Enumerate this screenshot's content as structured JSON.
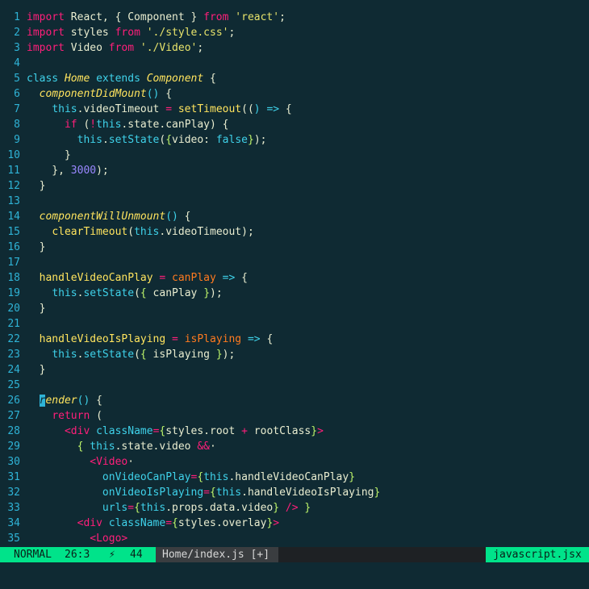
{
  "editor": {
    "lines": [
      {
        "n": "1",
        "t": [
          [
            "k",
            "import"
          ],
          [
            "w",
            " React, { Component } "
          ],
          [
            "k",
            "from"
          ],
          [
            "s",
            " 'react'"
          ],
          [
            "w",
            ";"
          ]
        ]
      },
      {
        "n": "2",
        "t": [
          [
            "k",
            "import"
          ],
          [
            "w",
            " styles "
          ],
          [
            "k",
            "from"
          ],
          [
            "s",
            " './style.css'"
          ],
          [
            "w",
            ";"
          ]
        ]
      },
      {
        "n": "3",
        "t": [
          [
            "k",
            "import"
          ],
          [
            "w",
            " Video "
          ],
          [
            "k",
            "from"
          ],
          [
            "s",
            " './Video'"
          ],
          [
            "w",
            ";"
          ]
        ]
      },
      {
        "n": "4",
        "t": []
      },
      {
        "n": "5",
        "t": [
          [
            "c",
            "class "
          ],
          [
            "yi",
            "Home "
          ],
          [
            "c",
            "extends "
          ],
          [
            "yi",
            "Component"
          ],
          [
            "w",
            " {"
          ]
        ]
      },
      {
        "n": "6",
        "t": [
          [
            "w",
            "  "
          ],
          [
            "yi",
            "componentDidMount"
          ],
          [
            "c",
            "()"
          ],
          [
            "w",
            " {"
          ]
        ]
      },
      {
        "n": "7",
        "t": [
          [
            "w",
            "    "
          ],
          [
            "c",
            "this"
          ],
          [
            "w",
            ".videoTimeout "
          ],
          [
            "k",
            "="
          ],
          [
            "w",
            " "
          ],
          [
            "y",
            "setTimeout"
          ],
          [
            "w",
            "(("
          ],
          [
            "c",
            ")"
          ],
          [
            "w",
            " "
          ],
          [
            "c",
            "=>"
          ],
          [
            "w",
            " {"
          ]
        ]
      },
      {
        "n": "8",
        "t": [
          [
            "w",
            "      "
          ],
          [
            "k",
            "if"
          ],
          [
            "w",
            " ("
          ],
          [
            "k",
            "!"
          ],
          [
            "c",
            "this"
          ],
          [
            "w",
            ".state.canPlay) {"
          ]
        ]
      },
      {
        "n": "9",
        "t": [
          [
            "w",
            "        "
          ],
          [
            "c",
            "this"
          ],
          [
            "w",
            "."
          ],
          [
            "c",
            "setState"
          ],
          [
            "w",
            "("
          ],
          [
            "p",
            "{"
          ],
          [
            "w",
            "video: "
          ],
          [
            "c",
            "false"
          ],
          [
            "p",
            "}"
          ],
          [
            "w",
            ");"
          ]
        ]
      },
      {
        "n": "10",
        "t": [
          [
            "w",
            "      }"
          ]
        ]
      },
      {
        "n": "11",
        "t": [
          [
            "w",
            "    }, "
          ],
          [
            "n",
            "3000"
          ],
          [
            "w",
            ");"
          ]
        ]
      },
      {
        "n": "12",
        "t": [
          [
            "w",
            "  }"
          ]
        ]
      },
      {
        "n": "13",
        "t": []
      },
      {
        "n": "14",
        "t": [
          [
            "w",
            "  "
          ],
          [
            "yi",
            "componentWillUnmount"
          ],
          [
            "c",
            "()"
          ],
          [
            "w",
            " {"
          ]
        ]
      },
      {
        "n": "15",
        "t": [
          [
            "w",
            "    "
          ],
          [
            "y",
            "clearTimeout"
          ],
          [
            "w",
            "("
          ],
          [
            "c",
            "this"
          ],
          [
            "w",
            ".videoTimeout);"
          ]
        ]
      },
      {
        "n": "16",
        "t": [
          [
            "w",
            "  }"
          ]
        ]
      },
      {
        "n": "17",
        "t": []
      },
      {
        "n": "18",
        "t": [
          [
            "w",
            "  "
          ],
          [
            "y",
            "handleVideoCanPlay"
          ],
          [
            "w",
            " "
          ],
          [
            "k",
            "="
          ],
          [
            "w",
            " "
          ],
          [
            "o",
            "canPlay"
          ],
          [
            "w",
            " "
          ],
          [
            "c",
            "=>"
          ],
          [
            "w",
            " {"
          ]
        ]
      },
      {
        "n": "19",
        "t": [
          [
            "w",
            "    "
          ],
          [
            "c",
            "this"
          ],
          [
            "w",
            "."
          ],
          [
            "c",
            "setState"
          ],
          [
            "w",
            "("
          ],
          [
            "p",
            "{"
          ],
          [
            "w",
            " canPlay "
          ],
          [
            "p",
            "}"
          ],
          [
            "w",
            ");"
          ]
        ]
      },
      {
        "n": "20",
        "t": [
          [
            "w",
            "  }"
          ]
        ]
      },
      {
        "n": "21",
        "t": []
      },
      {
        "n": "22",
        "t": [
          [
            "w",
            "  "
          ],
          [
            "y",
            "handleVideoIsPlaying"
          ],
          [
            "w",
            " "
          ],
          [
            "k",
            "="
          ],
          [
            "w",
            " "
          ],
          [
            "o",
            "isPlaying"
          ],
          [
            "w",
            " "
          ],
          [
            "c",
            "=>"
          ],
          [
            "w",
            " {"
          ]
        ]
      },
      {
        "n": "23",
        "t": [
          [
            "w",
            "    "
          ],
          [
            "c",
            "this"
          ],
          [
            "w",
            "."
          ],
          [
            "c",
            "setState"
          ],
          [
            "w",
            "("
          ],
          [
            "p",
            "{"
          ],
          [
            "w",
            " isPlaying "
          ],
          [
            "p",
            "}"
          ],
          [
            "w",
            ");"
          ]
        ]
      },
      {
        "n": "24",
        "t": [
          [
            "w",
            "  }"
          ]
        ]
      },
      {
        "n": "25",
        "t": []
      },
      {
        "n": "26",
        "t": [
          [
            "w",
            "  "
          ],
          [
            "cur",
            "r"
          ],
          [
            "yi",
            "ender"
          ],
          [
            "c",
            "()"
          ],
          [
            "w",
            " {"
          ]
        ]
      },
      {
        "n": "27",
        "t": [
          [
            "w",
            "    "
          ],
          [
            "k",
            "return"
          ],
          [
            "w",
            " ("
          ]
        ]
      },
      {
        "n": "28",
        "t": [
          [
            "w",
            "      "
          ],
          [
            "k",
            "<"
          ],
          [
            "k",
            "div"
          ],
          [
            "w",
            " "
          ],
          [
            "c",
            "className"
          ],
          [
            "k",
            "="
          ],
          [
            "p",
            "{"
          ],
          [
            "w",
            "styles.root "
          ],
          [
            "k",
            "+"
          ],
          [
            "w",
            " rootClass"
          ],
          [
            "p",
            "}"
          ],
          [
            "k",
            ">"
          ]
        ]
      },
      {
        "n": "29",
        "t": [
          [
            "w",
            "        "
          ],
          [
            "p",
            "{"
          ],
          [
            "w",
            " "
          ],
          [
            "c",
            "this"
          ],
          [
            "w",
            ".state.video "
          ],
          [
            "k",
            "&&"
          ],
          [
            "w",
            "·"
          ]
        ]
      },
      {
        "n": "30",
        "t": [
          [
            "w",
            "          "
          ],
          [
            "k",
            "<Video"
          ],
          [
            "w",
            "·"
          ]
        ]
      },
      {
        "n": "31",
        "t": [
          [
            "w",
            "            "
          ],
          [
            "c",
            "onVideoCanPlay"
          ],
          [
            "k",
            "="
          ],
          [
            "p",
            "{"
          ],
          [
            "c",
            "this"
          ],
          [
            "w",
            ".handleVideoCanPlay"
          ],
          [
            "p",
            "}"
          ]
        ]
      },
      {
        "n": "32",
        "t": [
          [
            "w",
            "            "
          ],
          [
            "c",
            "onVideoIsPlaying"
          ],
          [
            "k",
            "="
          ],
          [
            "p",
            "{"
          ],
          [
            "c",
            "this"
          ],
          [
            "w",
            ".handleVideoIsPlaying"
          ],
          [
            "p",
            "}"
          ]
        ]
      },
      {
        "n": "33",
        "t": [
          [
            "w",
            "            "
          ],
          [
            "c",
            "urls"
          ],
          [
            "k",
            "="
          ],
          [
            "p",
            "{"
          ],
          [
            "c",
            "this"
          ],
          [
            "w",
            ".props.data.video"
          ],
          [
            "p",
            "}"
          ],
          [
            "w",
            " "
          ],
          [
            "k",
            "/>"
          ],
          [
            "w",
            " "
          ],
          [
            "p",
            "}"
          ]
        ]
      },
      {
        "n": "34",
        "t": [
          [
            "w",
            "        "
          ],
          [
            "k",
            "<div"
          ],
          [
            "w",
            " "
          ],
          [
            "c",
            "className"
          ],
          [
            "k",
            "="
          ],
          [
            "p",
            "{"
          ],
          [
            "w",
            "styles.overlay"
          ],
          [
            "p",
            "}"
          ],
          [
            "k",
            ">"
          ]
        ]
      },
      {
        "n": "35",
        "t": [
          [
            "w",
            "          "
          ],
          [
            "k",
            "<Logo>"
          ]
        ]
      }
    ]
  },
  "status": {
    "mode": "NORMAL",
    "position": "26:3",
    "bolt": "⚡",
    "col": "44",
    "file": "Home/index.js [+]",
    "filetype": "javascript.jsx"
  }
}
